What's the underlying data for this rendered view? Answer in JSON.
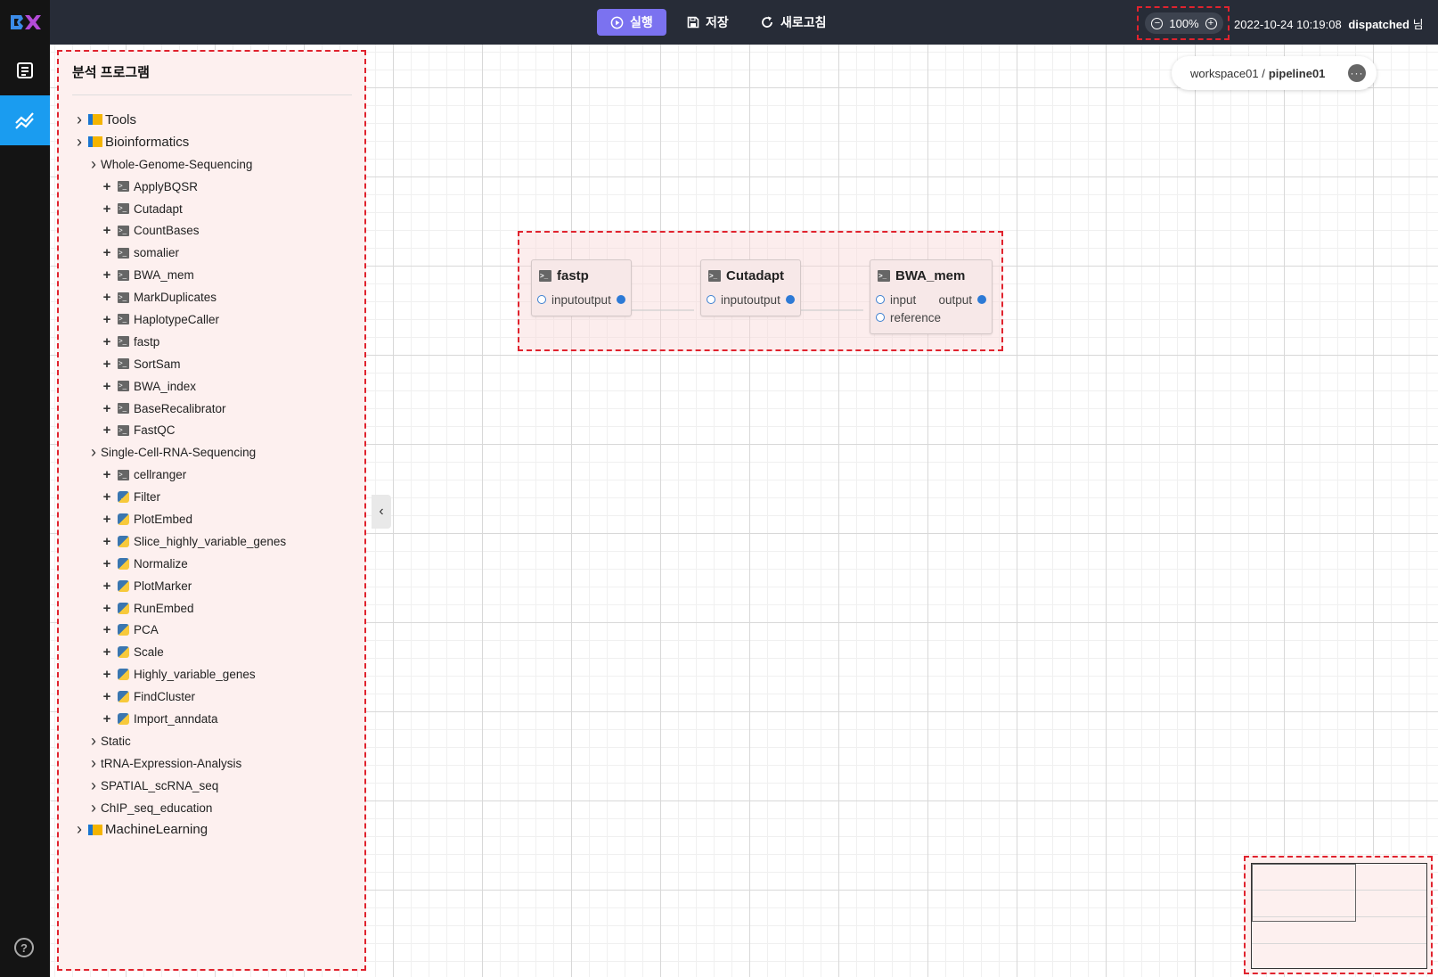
{
  "topbar": {
    "run_label": "실행",
    "save_label": "저장",
    "refresh_label": "새로고침",
    "zoom_level": "100%",
    "datetime": "2022-10-24 10:19:08",
    "user": "dispatched",
    "user_suffix": "님"
  },
  "breadcrumb": {
    "workspace": "workspace01 /",
    "pipeline": "pipeline01",
    "more": "···"
  },
  "panel": {
    "title": "분석 프로그램",
    "tree": [
      {
        "label": "Tools",
        "level": 0,
        "type": "folder"
      },
      {
        "label": "Bioinformatics",
        "level": 0,
        "type": "folder"
      },
      {
        "label": "Whole-Genome-Sequencing",
        "level": 1,
        "type": "category"
      },
      {
        "label": "ApplyBQSR",
        "level": 2,
        "type": "terminal"
      },
      {
        "label": "Cutadapt",
        "level": 2,
        "type": "terminal"
      },
      {
        "label": "CountBases",
        "level": 2,
        "type": "terminal"
      },
      {
        "label": "somalier",
        "level": 2,
        "type": "terminal"
      },
      {
        "label": "BWA_mem",
        "level": 2,
        "type": "terminal"
      },
      {
        "label": "MarkDuplicates",
        "level": 2,
        "type": "terminal"
      },
      {
        "label": "HaplotypeCaller",
        "level": 2,
        "type": "terminal"
      },
      {
        "label": "fastp",
        "level": 2,
        "type": "terminal"
      },
      {
        "label": "SortSam",
        "level": 2,
        "type": "terminal"
      },
      {
        "label": "BWA_index",
        "level": 2,
        "type": "terminal"
      },
      {
        "label": "BaseRecalibrator",
        "level": 2,
        "type": "terminal"
      },
      {
        "label": "FastQC",
        "level": 2,
        "type": "terminal"
      },
      {
        "label": "Single-Cell-RNA-Sequencing",
        "level": 1,
        "type": "category"
      },
      {
        "label": "cellranger",
        "level": 2,
        "type": "terminal"
      },
      {
        "label": "Filter",
        "level": 2,
        "type": "python"
      },
      {
        "label": "PlotEmbed",
        "level": 2,
        "type": "python"
      },
      {
        "label": "Slice_highly_variable_genes",
        "level": 2,
        "type": "python"
      },
      {
        "label": "Normalize",
        "level": 2,
        "type": "python"
      },
      {
        "label": "PlotMarker",
        "level": 2,
        "type": "python"
      },
      {
        "label": "RunEmbed",
        "level": 2,
        "type": "python"
      },
      {
        "label": "PCA",
        "level": 2,
        "type": "python"
      },
      {
        "label": "Scale",
        "level": 2,
        "type": "python"
      },
      {
        "label": "Highly_variable_genes",
        "level": 2,
        "type": "python"
      },
      {
        "label": "FindCluster",
        "level": 2,
        "type": "python"
      },
      {
        "label": "Import_anndata",
        "level": 2,
        "type": "python"
      },
      {
        "label": "Static",
        "level": 1,
        "type": "category"
      },
      {
        "label": "tRNA-Expression-Analysis",
        "level": 1,
        "type": "category"
      },
      {
        "label": "SPATIAL_scRNA_seq",
        "level": 1,
        "type": "category"
      },
      {
        "label": "ChIP_seq_education",
        "level": 1,
        "type": "category"
      },
      {
        "label": "MachineLearning",
        "level": 0,
        "type": "folder"
      }
    ]
  },
  "pipeline": {
    "nodes": [
      {
        "title": "fastp",
        "inputs": [
          "input"
        ],
        "outputs": [
          "output"
        ]
      },
      {
        "title": "Cutadapt",
        "inputs": [
          "input"
        ],
        "outputs": [
          "output"
        ]
      },
      {
        "title": "BWA_mem",
        "inputs": [
          "input",
          "reference"
        ],
        "outputs": [
          "output"
        ]
      }
    ]
  },
  "colors": {
    "accent": "#7b72f0",
    "active_nav": "#1a9cf0",
    "highlight": "#e0232e",
    "port": "#2d7ad6"
  },
  "icons": {
    "run": "play-circle-icon",
    "save": "floppy-icon",
    "refresh": "refresh-icon",
    "zoom_out": "zoom-out-icon",
    "zoom_in": "zoom-in-icon",
    "nav_doc": "document-icon",
    "nav_pipeline": "pipeline-chart-icon",
    "help": "help-icon"
  }
}
